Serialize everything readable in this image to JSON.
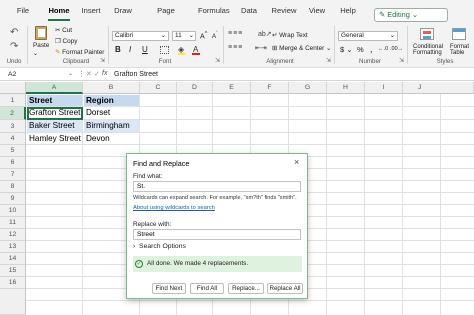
{
  "menu": {
    "tabs": [
      "File",
      "Home",
      "Insert",
      "Draw",
      "Page Layout",
      "Formulas",
      "Data",
      "Review",
      "View",
      "Help"
    ],
    "active": "Home",
    "editing_label": "Editing"
  },
  "ribbon": {
    "undo": "Undo",
    "clipboard": {
      "paste": "Paste",
      "cut": "Cut",
      "copy": "Copy",
      "format_painter": "Format Painter",
      "group": "Clipboard"
    },
    "font": {
      "name": "Calibri",
      "size": "11",
      "group": "Font",
      "bold": "B",
      "italic": "I",
      "underline": "U"
    },
    "alignment": {
      "wrap_text": "Wrap Text",
      "merge": "Merge & Center",
      "group": "Alignment"
    },
    "number": {
      "format": "General",
      "currency": "$",
      "percent": "%",
      "comma": ",",
      "group": "Number"
    },
    "styles": {
      "conditional": "Conditional",
      "conditional2": "Formatting",
      "format_table": "Format",
      "format_table2": "Table",
      "group": "Styles"
    }
  },
  "formula_bar": {
    "name_box": "A2",
    "fx": "fx",
    "content": "Grafton Street"
  },
  "grid": {
    "columns": [
      "A",
      "B",
      "C",
      "D",
      "E",
      "F",
      "G",
      "H",
      "I",
      "J"
    ],
    "rows": [
      "1",
      "2",
      "3",
      "4",
      "5",
      "6",
      "7",
      "8",
      "9",
      "10",
      "11",
      "12",
      "13",
      "14",
      "15",
      "16"
    ],
    "headers": [
      "Street",
      "Region"
    ],
    "data": [
      [
        "Grafton Street",
        "Dorset"
      ],
      [
        "Baker Street",
        "Birmingham"
      ],
      [
        "Hamley Street",
        "Devon"
      ]
    ]
  },
  "dialog": {
    "title": "Find and Replace",
    "close": "×",
    "find_label": "Find what:",
    "find_value": "St.",
    "hint": "Wildcards can expand search. For example, \"sm?th\" finds \"smith\".",
    "hint_link": "About using wildcards to search",
    "replace_label": "Replace with:",
    "replace_value": "Street",
    "search_options": "Search Options",
    "success": "All done. We made 4 replacements.",
    "buttons": {
      "find_next": "Find Next",
      "find_all": "Find All",
      "replace": "Replace...",
      "replace_all": "Replace All"
    }
  },
  "colors": {
    "accent": "#217346",
    "header_fill": "#c6d9ef",
    "table_fill": "#dbe7f4",
    "success_bg": "#dff1df"
  }
}
